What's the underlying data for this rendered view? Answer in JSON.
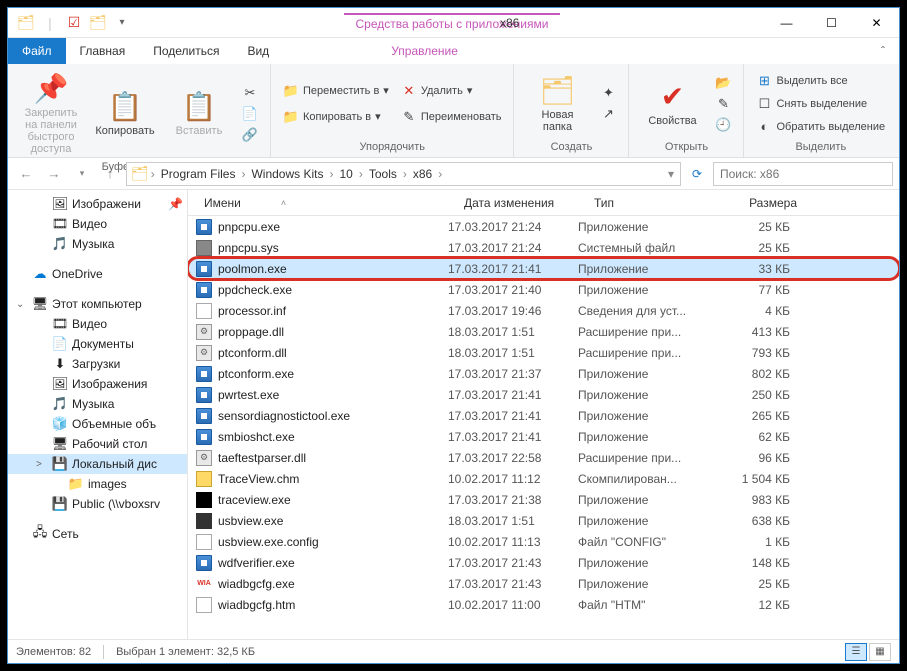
{
  "title": "x86",
  "contextual_tab": "Средства работы с приложениями",
  "tabs": {
    "file": "Файл",
    "home": "Главная",
    "share": "Поделиться",
    "view": "Вид",
    "manage": "Управление"
  },
  "ribbon": {
    "clipboard": {
      "pin": "Закрепить на панели\nбыстрого доступа",
      "copy": "Копировать",
      "paste": "Вставить",
      "label": "Буфер обмена"
    },
    "organize": {
      "move": "Переместить в",
      "copyto": "Копировать в",
      "delete": "Удалить",
      "rename": "Переименовать",
      "label": "Упорядочить"
    },
    "new": {
      "folder": "Новая\nпапка",
      "label": "Создать"
    },
    "open": {
      "props": "Свойства",
      "label": "Открыть"
    },
    "select": {
      "all": "Выделить все",
      "none": "Снять выделение",
      "invert": "Обратить выделение",
      "label": "Выделить"
    }
  },
  "breadcrumb": [
    "Program Files",
    "Windows Kits",
    "10",
    "Tools",
    "x86"
  ],
  "search_placeholder": "Поиск: x86",
  "nav": {
    "quick": [
      {
        "label": "Изображени",
        "icon": "🖼",
        "pinned": true
      },
      {
        "label": "Видео",
        "icon": "🎞",
        "pinned": false
      },
      {
        "label": "Музыка",
        "icon": "🎵",
        "pinned": false
      }
    ],
    "onedrive": "OneDrive",
    "thispc": "Этот компьютер",
    "pc_items": [
      {
        "label": "Видео",
        "icon": "🎞"
      },
      {
        "label": "Документы",
        "icon": "📄"
      },
      {
        "label": "Загрузки",
        "icon": "⬇"
      },
      {
        "label": "Изображения",
        "icon": "🖼"
      },
      {
        "label": "Музыка",
        "icon": "🎵"
      },
      {
        "label": "Объемные объ",
        "icon": "🧊"
      },
      {
        "label": "Рабочий стол",
        "icon": "🖥"
      },
      {
        "label": "Локальный дис",
        "icon": "💾",
        "selected": true
      },
      {
        "label": "images",
        "icon": "📁",
        "indent": 2
      },
      {
        "label": "Public (\\\\vboxsrv",
        "icon": "💾"
      }
    ],
    "network": "Сеть"
  },
  "columns": {
    "name": "Имени",
    "date": "Дата изменения",
    "type": "Тип",
    "size": "Размера"
  },
  "files": [
    {
      "name": "pnpcpu.exe",
      "date": "17.03.2017 21:24",
      "type": "Приложение",
      "size": "25 КБ",
      "icon": "exe"
    },
    {
      "name": "pnpcpu.sys",
      "date": "17.03.2017 21:24",
      "type": "Системный файл",
      "size": "25 КБ",
      "icon": "sys"
    },
    {
      "name": "poolmon.exe",
      "date": "17.03.2017 21:41",
      "type": "Приложение",
      "size": "33 КБ",
      "icon": "exe",
      "selected": true,
      "highlighted": true
    },
    {
      "name": "ppdcheck.exe",
      "date": "17.03.2017 21:40",
      "type": "Приложение",
      "size": "77 КБ",
      "icon": "exe"
    },
    {
      "name": "processor.inf",
      "date": "17.03.2017 19:46",
      "type": "Сведения для уст...",
      "size": "4 КБ",
      "icon": "inf"
    },
    {
      "name": "proppage.dll",
      "date": "18.03.2017 1:51",
      "type": "Расширение при...",
      "size": "413 КБ",
      "icon": "dll"
    },
    {
      "name": "ptconform.dll",
      "date": "18.03.2017 1:51",
      "type": "Расширение при...",
      "size": "793 КБ",
      "icon": "dll"
    },
    {
      "name": "ptconform.exe",
      "date": "17.03.2017 21:37",
      "type": "Приложение",
      "size": "802 КБ",
      "icon": "exe"
    },
    {
      "name": "pwrtest.exe",
      "date": "17.03.2017 21:41",
      "type": "Приложение",
      "size": "250 КБ",
      "icon": "exe"
    },
    {
      "name": "sensordiagnostictool.exe",
      "date": "17.03.2017 21:41",
      "type": "Приложение",
      "size": "265 КБ",
      "icon": "exe"
    },
    {
      "name": "smbioshct.exe",
      "date": "17.03.2017 21:41",
      "type": "Приложение",
      "size": "62 КБ",
      "icon": "exe"
    },
    {
      "name": "taeftestparser.dll",
      "date": "17.03.2017 22:58",
      "type": "Расширение при...",
      "size": "96 КБ",
      "icon": "dll"
    },
    {
      "name": "TraceView.chm",
      "date": "10.02.2017 11:12",
      "type": "Скомпилирован...",
      "size": "1 504 КБ",
      "icon": "chm"
    },
    {
      "name": "traceview.exe",
      "date": "17.03.2017 21:38",
      "type": "Приложение",
      "size": "983 КБ",
      "icon": "special1"
    },
    {
      "name": "usbview.exe",
      "date": "18.03.2017 1:51",
      "type": "Приложение",
      "size": "638 КБ",
      "icon": "special2"
    },
    {
      "name": "usbview.exe.config",
      "date": "10.02.2017 11:13",
      "type": "Файл \"CONFIG\"",
      "size": "1 КБ",
      "icon": "config"
    },
    {
      "name": "wdfverifier.exe",
      "date": "17.03.2017 21:43",
      "type": "Приложение",
      "size": "148 КБ",
      "icon": "exe"
    },
    {
      "name": "wiadbgcfg.exe",
      "date": "17.03.2017 21:43",
      "type": "Приложение",
      "size": "25 КБ",
      "icon": "wia"
    },
    {
      "name": "wiadbgcfg.htm",
      "date": "10.02.2017 11:00",
      "type": "Файл \"HTM\"",
      "size": "12 КБ",
      "icon": "htm"
    }
  ],
  "status": {
    "count": "Элементов: 82",
    "selected": "Выбран 1 элемент: 32,5 КБ"
  }
}
